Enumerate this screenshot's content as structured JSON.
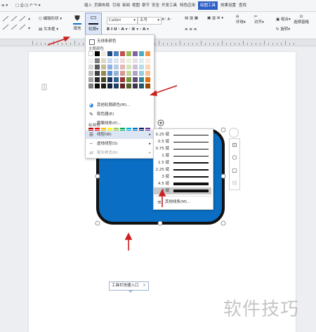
{
  "tabs": [
    "插入",
    "页面布局",
    "引用",
    "审阅",
    "视图",
    "章节",
    "安全",
    "开发工具",
    "特色应用",
    "绘图工具",
    "效果设置",
    "查找"
  ],
  "active_tab_index": 9,
  "ribbon": {
    "edit_shape": "编辑形状",
    "text_box": "文本框",
    "fill": "填充",
    "outline": "轮廓",
    "font_name": "Calibri",
    "font_size": "五号",
    "wrap": "环绕",
    "align": "对齐",
    "rotate": "旋转",
    "combine": "组合",
    "select_pane": "选择窗格"
  },
  "outline_menu": {
    "no_line": "无线条颜色",
    "theme_colors_title": "主题颜色",
    "standard_colors_title": "标准色",
    "more_colors": "其他轮廓颜色(M)...",
    "eyedropper": "取色器(E)",
    "image_outline": "图案线条(P)...",
    "weight": "线型(W)",
    "dash": "虚线线型(S)",
    "arrow": "箭头样式(R)"
  },
  "theme_colors": [
    [
      "#ffffff",
      "#000000",
      "#eeece1",
      "#1f497d",
      "#4f81bd",
      "#c0504d",
      "#9bbb59",
      "#8064a2",
      "#4bacc6",
      "#f79646"
    ],
    [
      "#f2f2f2",
      "#7f7f7f",
      "#ddd9c3",
      "#c6d9f0",
      "#dbe5f1",
      "#f2dcdb",
      "#ebf1dd",
      "#e5e0ec",
      "#dbeef3",
      "#fdeada"
    ],
    [
      "#d8d8d8",
      "#595959",
      "#c4bd97",
      "#8db3e2",
      "#b8cce4",
      "#e5b9b7",
      "#d7e3bc",
      "#ccc1d9",
      "#b7dde8",
      "#fbd5b5"
    ],
    [
      "#bfbfbf",
      "#3f3f3f",
      "#938953",
      "#548dd4",
      "#95b3d7",
      "#d99694",
      "#c3d69b",
      "#b2a2c7",
      "#92cddc",
      "#fac08f"
    ],
    [
      "#a5a5a5",
      "#262626",
      "#494429",
      "#17365d",
      "#366092",
      "#953734",
      "#76923c",
      "#5f497a",
      "#31859b",
      "#e36c09"
    ],
    [
      "#7f7f7f",
      "#0c0c0c",
      "#1d1b10",
      "#0f243e",
      "#244061",
      "#632423",
      "#4f6128",
      "#3f3151",
      "#205867",
      "#974806"
    ]
  ],
  "standard_colors": [
    "#c00000",
    "#ff0000",
    "#ffc000",
    "#ffff00",
    "#92d050",
    "#00b050",
    "#00b0f0",
    "#0070c0",
    "#002060",
    "#7030a0"
  ],
  "weight_menu": {
    "items": [
      "0.25 磅",
      "0.5 磅",
      "0.75 磅",
      "1 磅",
      "1.5 磅",
      "2.25 磅",
      "3 磅",
      "4.5 磅",
      "6 磅"
    ],
    "selected_index": 8,
    "more": "其他线条(M)..."
  },
  "shape": {
    "fill_color": "#0a6fc4",
    "outline_color": "#111111"
  },
  "quick_entry": "工具栏快捷入口",
  "watermark": "软件技巧"
}
